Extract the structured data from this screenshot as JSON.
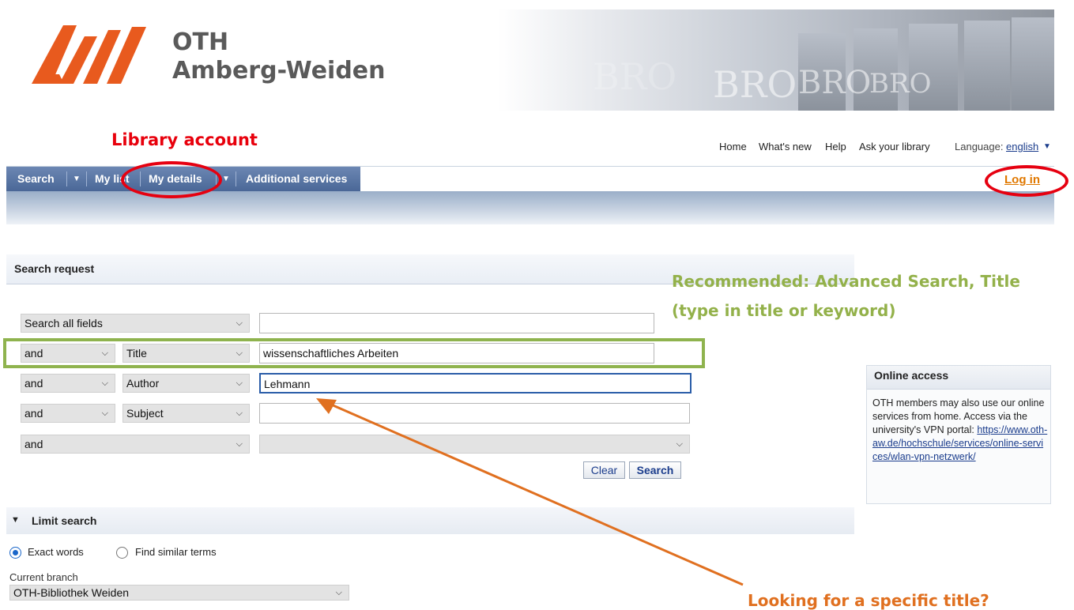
{
  "header": {
    "org_line1": "OTH",
    "org_line2": "Amberg-Weiden",
    "banner_words": [
      "BRO",
      "BRO",
      "BRO",
      "BRO"
    ],
    "brand_color": "#e85a1e"
  },
  "annotations": {
    "library_account": "Library account",
    "recommended_line1": "Recommended: Advanced Search, Title",
    "recommended_line2": "(type in title or keyword)",
    "looking_for": "Looking for a specific title?"
  },
  "top_links": {
    "home": "Home",
    "whats_new": "What's new",
    "help": "Help",
    "ask": "Ask your library",
    "language_label": "Language:",
    "language_value": "english"
  },
  "nav": {
    "search": "Search",
    "my_list": "My list",
    "my_details": "My details",
    "additional": "Additional services",
    "login": "Log in"
  },
  "search_request": {
    "title": "Search request",
    "rows": [
      {
        "op": "",
        "field": "Search all fields",
        "value": ""
      },
      {
        "op": "and",
        "field": "Title",
        "value": "wissenschaftliches Arbeiten"
      },
      {
        "op": "and",
        "field": "Author",
        "value": "Lehmann"
      },
      {
        "op": "and",
        "field": "Subject",
        "value": ""
      },
      {
        "op": "and",
        "field": "",
        "value": ""
      }
    ],
    "clear_label": "Clear",
    "search_label": "Search"
  },
  "online_access": {
    "title": "Online access",
    "text": "OTH members may also use our online services from home. Access via the university's VPN portal:",
    "link": "https://www.oth-aw.de/hochschule/services/online-services/wlan-vpn-netzwerk/"
  },
  "limit_search": {
    "title": "Limit search",
    "exact_words": "Exact words",
    "similar_terms": "Find similar terms",
    "branch_label": "Current branch",
    "branch_value": "OTH-Bibliothek Weiden"
  }
}
